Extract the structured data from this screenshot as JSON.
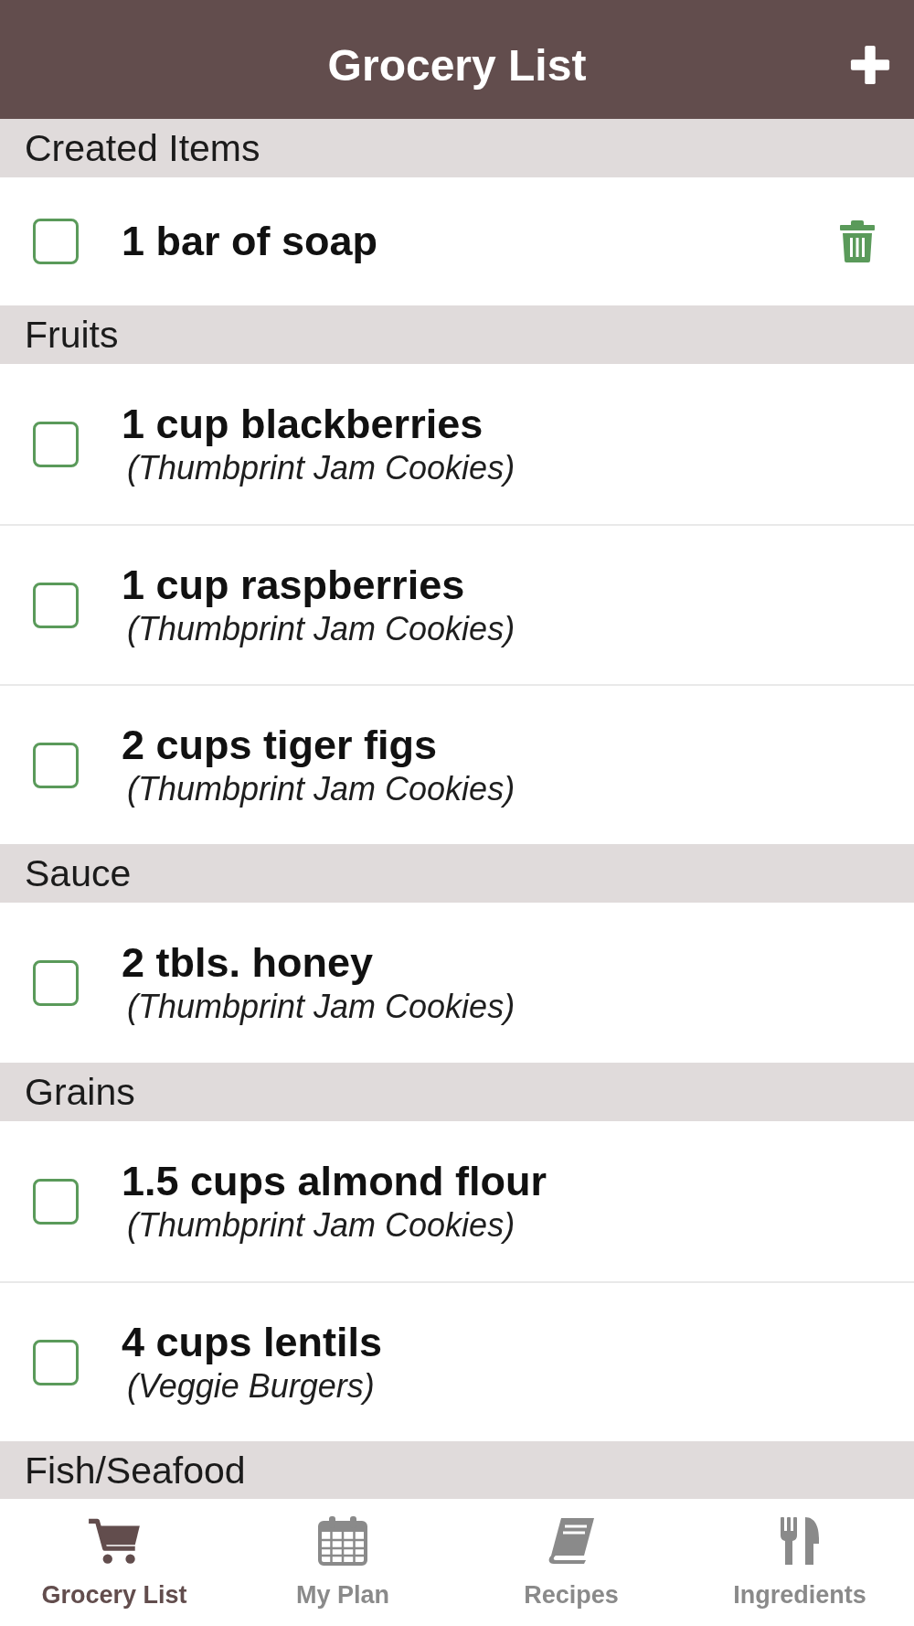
{
  "app_bar": {
    "title": "Grocery List"
  },
  "sections": [
    {
      "title": "Created Items",
      "items": [
        {
          "kind": "custom",
          "name": "1 bar of soap",
          "checked": false
        }
      ]
    },
    {
      "title": "Fruits",
      "items": [
        {
          "kind": "recipe",
          "name": "1 cup blackberries",
          "source": "(Thumbprint Jam Cookies)",
          "checked": false
        },
        {
          "kind": "recipe",
          "name": "1 cup raspberries",
          "source": "(Thumbprint Jam Cookies)",
          "checked": false
        },
        {
          "kind": "recipe",
          "name": "2 cups tiger figs",
          "source": "(Thumbprint Jam Cookies)",
          "checked": false
        }
      ]
    },
    {
      "title": "Sauce",
      "items": [
        {
          "kind": "recipe",
          "name": "2 tbls. honey",
          "source": "(Thumbprint Jam Cookies)",
          "checked": false
        }
      ]
    },
    {
      "title": "Grains",
      "items": [
        {
          "kind": "recipe",
          "name": "1.5 cups almond flour",
          "source": "(Thumbprint Jam Cookies)",
          "checked": false
        },
        {
          "kind": "recipe",
          "name": "4 cups lentils",
          "source": "(Veggie Burgers)",
          "checked": false
        }
      ]
    },
    {
      "title": "Fish/Seafood"
    }
  ],
  "nav": [
    {
      "label": "Grocery List",
      "selected": true
    },
    {
      "label": "My Plan",
      "selected": false
    },
    {
      "label": "Recipes",
      "selected": false
    },
    {
      "label": "Ingredients",
      "selected": false
    }
  ]
}
